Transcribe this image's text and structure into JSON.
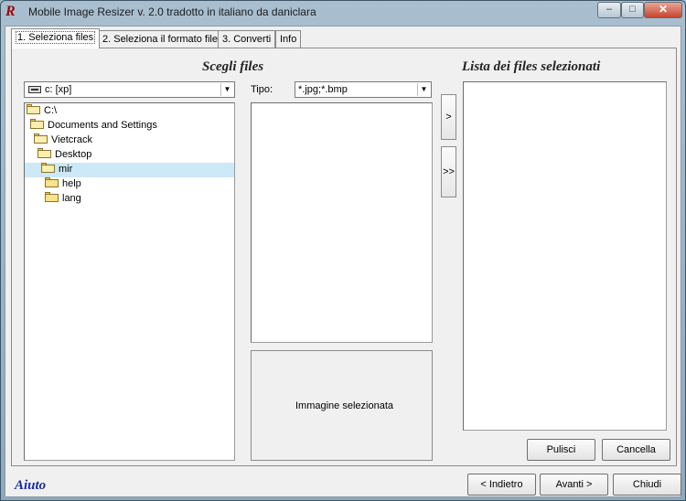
{
  "window": {
    "title": "Mobile Image Resizer v. 2.0 tradotto in italiano da daniclara",
    "app_icon": "R",
    "controls": {
      "minimize": "–",
      "maximize": "□",
      "close": "✕"
    }
  },
  "tabs": [
    {
      "label": "1. Seleziona files",
      "active": true
    },
    {
      "label": "2. Seleziona il formato file",
      "active": false
    },
    {
      "label": "3. Converti",
      "active": false
    },
    {
      "label": "Info",
      "active": false
    }
  ],
  "left": {
    "heading": "Scegli files",
    "drive": "c: [xp]",
    "tree": [
      {
        "label": "C:\\",
        "open": true,
        "selected": false
      },
      {
        "label": "Documents and Settings",
        "open": true,
        "selected": false
      },
      {
        "label": "Vietcrack",
        "open": true,
        "selected": false
      },
      {
        "label": "Desktop",
        "open": true,
        "selected": false
      },
      {
        "label": "mir",
        "open": true,
        "selected": true
      },
      {
        "label": "help",
        "open": false,
        "selected": false
      },
      {
        "label": "lang",
        "open": false,
        "selected": false
      }
    ],
    "type_label": "Tipo:",
    "type_value": "*.jpg;*.bmp",
    "preview_text": "Immagine selezionata"
  },
  "middle": {
    "add_one": ">",
    "add_all": ">>"
  },
  "right": {
    "heading": "Lista dei files selezionati",
    "clear_button": "Pulisci",
    "delete_button": "Cancella"
  },
  "footer": {
    "help": "Aiuto",
    "back_button": "< Indietro",
    "next_button": "Avanti >",
    "close_button": "Chiudi"
  },
  "colors": {
    "selection": "#cde8f7",
    "help_link": "#1c2aa0",
    "close_button": "#c6452e"
  }
}
